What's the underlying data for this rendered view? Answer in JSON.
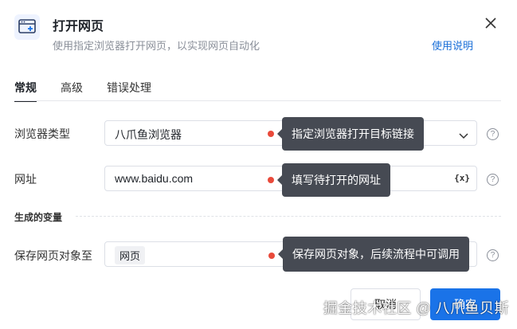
{
  "dialog": {
    "title": "打开网页",
    "subtitle": "使用指定浏览器打开网页，以实现网页自动化",
    "help_link": "使用说明"
  },
  "tabs": [
    {
      "label": "常规",
      "active": true
    },
    {
      "label": "高级",
      "active": false
    },
    {
      "label": "错误处理",
      "active": false
    }
  ],
  "fields": {
    "browser": {
      "label": "浏览器类型",
      "value": "八爪鱼浏览器",
      "tooltip": "指定浏览器打开目标链接"
    },
    "url": {
      "label": "网址",
      "value": "www.baidu.com",
      "var_btn": "{x}",
      "tooltip": "填写待打开的网址"
    },
    "output_section": "生成的变量",
    "save": {
      "label": "保存网页对象至",
      "tag": "网页",
      "tooltip": "保存网页对象，后续流程中可调用"
    }
  },
  "help_icon_text": "?",
  "buttons": {
    "cancel": "取消",
    "ok": "确定"
  },
  "watermark": "掘金技术社区 @ 八爪鱼贝斯",
  "colors": {
    "accent": "#1a73e8",
    "tooltip_bg": "#464a53",
    "dot": "#e94a3b"
  }
}
